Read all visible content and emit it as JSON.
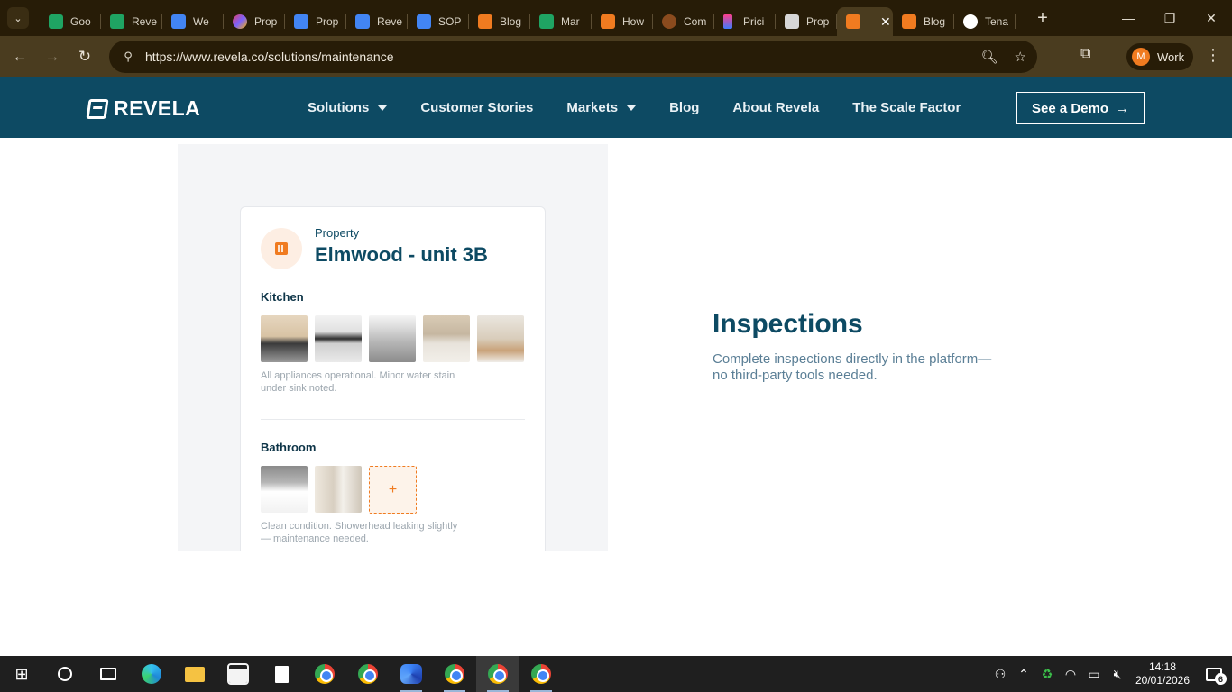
{
  "browser": {
    "tabs": [
      {
        "label": "Goo",
        "favicon": "sheets"
      },
      {
        "label": "Reve",
        "favicon": "sheets"
      },
      {
        "label": "We",
        "favicon": "docs"
      },
      {
        "label": "Prop",
        "favicon": "multi"
      },
      {
        "label": "Prop",
        "favicon": "docs"
      },
      {
        "label": "Reve",
        "favicon": "docs"
      },
      {
        "label": "SOP",
        "favicon": "docs"
      },
      {
        "label": "Blog",
        "favicon": "revela"
      },
      {
        "label": "Mar",
        "favicon": "sheets"
      },
      {
        "label": "How",
        "favicon": "revela"
      },
      {
        "label": "Com",
        "favicon": "com"
      },
      {
        "label": "Prici",
        "favicon": "pric"
      },
      {
        "label": "Prop",
        "favicon": "prop2"
      },
      {
        "label": "",
        "favicon": "revela",
        "active": true
      },
      {
        "label": "Blog",
        "favicon": "revela"
      },
      {
        "label": "Tena",
        "favicon": "google"
      }
    ],
    "active_tab_close": "✕",
    "new_tab": "+",
    "url": "https://www.revela.co/solutions/maintenance",
    "profile": {
      "initial": "M",
      "name": "Work",
      "color": "#f07b20"
    }
  },
  "site": {
    "logo_text": "REVELA",
    "nav": [
      {
        "label": "Solutions",
        "dropdown": true
      },
      {
        "label": "Customer Stories",
        "dropdown": false
      },
      {
        "label": "Markets",
        "dropdown": true
      },
      {
        "label": "Blog",
        "dropdown": false
      },
      {
        "label": "About Revela",
        "dropdown": false
      },
      {
        "label": "The Scale Factor",
        "dropdown": false
      }
    ],
    "cta_label": "See a Demo",
    "cta_arrow": "→",
    "header_color": "#0d4a63",
    "accent_color": "#f07b20"
  },
  "inspection_card": {
    "kicker": "Property",
    "title": "Elmwood - unit 3B",
    "sections": [
      {
        "label": "Kitchen",
        "photo_count": 5,
        "note": "All appliances operational. Minor water stain under sink noted."
      },
      {
        "label": "Bathroom",
        "photo_count": 2,
        "add_label": "+",
        "note": "Clean condition. Showerhead leaking slightly — maintenance needed."
      }
    ]
  },
  "feature": {
    "title": "Inspections",
    "description": "Complete inspections directly in the platform—no third-party tools needed."
  },
  "taskbar": {
    "time": "14:18",
    "date": "20/01/2026",
    "notification_count": "6"
  }
}
